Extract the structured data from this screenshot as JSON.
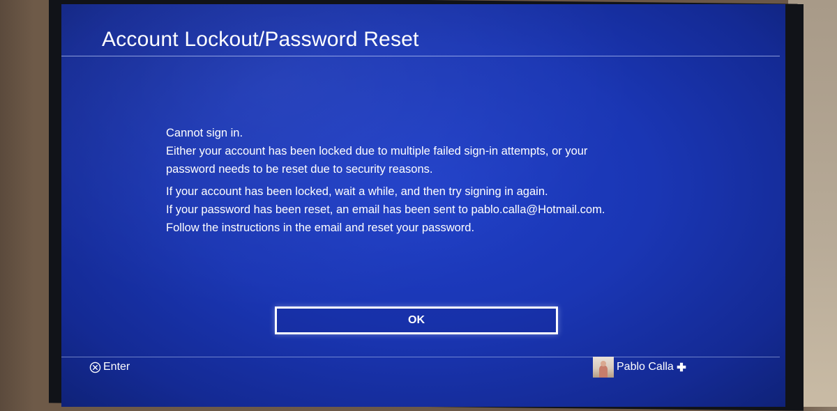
{
  "dialog": {
    "title": "Account Lockout/Password Reset",
    "message_lines_1": [
      "Cannot sign in.",
      "Either your account has been locked due to multiple failed sign-in attempts, or your",
      "password needs to be reset due to security reasons."
    ],
    "message_lines_2": [
      "If your account has been locked, wait a while, and then try signing in again.",
      "If your password has been reset, an email has been sent to pablo.calla@Hotmail.com.",
      "Follow the instructions in the email and reset your password."
    ],
    "ok_label": "OK"
  },
  "footer": {
    "enter_icon": "cross-button-icon",
    "enter_label": "Enter",
    "user_name": "Pablo Calla",
    "plus_icon": "playstation-plus-icon"
  },
  "colors": {
    "screen_blue": "#1a36b4",
    "text": "#ffffff",
    "plus_gold": "#f1c232"
  }
}
